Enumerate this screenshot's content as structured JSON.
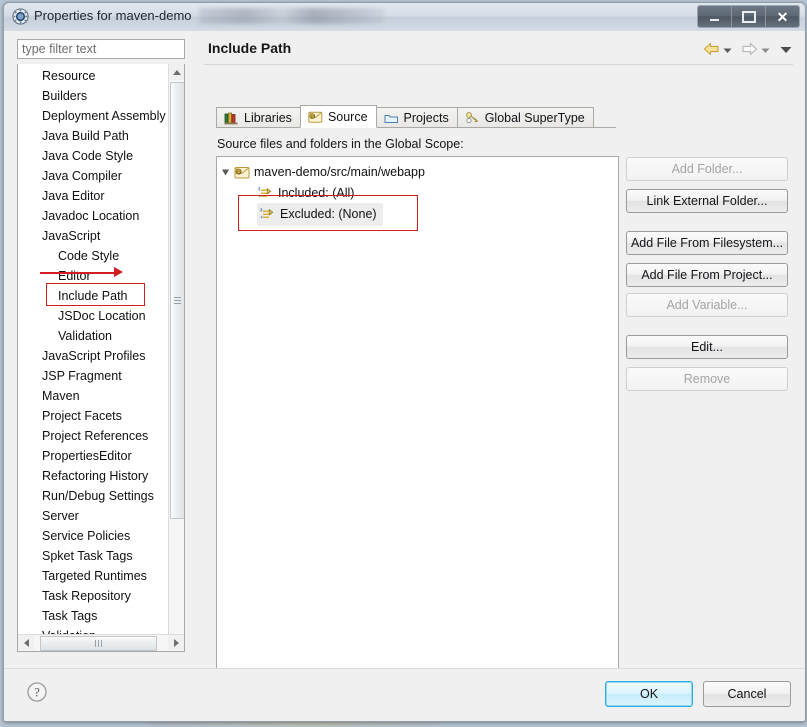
{
  "window": {
    "title": "Properties for maven-demo",
    "icon": "gear-icon",
    "controls": {
      "minimize": "Minimize",
      "maximize": "Maximize",
      "close": "Close"
    }
  },
  "filter": {
    "placeholder": "type filter text",
    "value": ""
  },
  "sidebar": {
    "items": [
      {
        "label": "Resource",
        "level": 0,
        "selected": false
      },
      {
        "label": "Builders",
        "level": 0,
        "selected": false
      },
      {
        "label": "Deployment Assembly",
        "level": 0,
        "selected": false
      },
      {
        "label": "Java Build Path",
        "level": 0,
        "selected": false
      },
      {
        "label": "Java Code Style",
        "level": 0,
        "selected": false
      },
      {
        "label": "Java Compiler",
        "level": 0,
        "selected": false
      },
      {
        "label": "Java Editor",
        "level": 0,
        "selected": false
      },
      {
        "label": "Javadoc Location",
        "level": 0,
        "selected": false
      },
      {
        "label": "JavaScript",
        "level": 0,
        "selected": false
      },
      {
        "label": "Code Style",
        "level": 1,
        "selected": false
      },
      {
        "label": "Editor",
        "level": 1,
        "selected": false
      },
      {
        "label": "Include Path",
        "level": 1,
        "selected": true
      },
      {
        "label": "JSDoc Location",
        "level": 1,
        "selected": false
      },
      {
        "label": "Validation",
        "level": 1,
        "selected": false
      },
      {
        "label": "JavaScript Profiles",
        "level": 0,
        "selected": false
      },
      {
        "label": "JSP Fragment",
        "level": 0,
        "selected": false
      },
      {
        "label": "Maven",
        "level": 0,
        "selected": false
      },
      {
        "label": "Project Facets",
        "level": 0,
        "selected": false
      },
      {
        "label": "Project References",
        "level": 0,
        "selected": false
      },
      {
        "label": "PropertiesEditor",
        "level": 0,
        "selected": false
      },
      {
        "label": "Refactoring History",
        "level": 0,
        "selected": false
      },
      {
        "label": "Run/Debug Settings",
        "level": 0,
        "selected": false
      },
      {
        "label": "Server",
        "level": 0,
        "selected": false
      },
      {
        "label": "Service Policies",
        "level": 0,
        "selected": false
      },
      {
        "label": "Spket Task Tags",
        "level": 0,
        "selected": false
      },
      {
        "label": "Targeted Runtimes",
        "level": 0,
        "selected": false
      },
      {
        "label": "Task Repository",
        "level": 0,
        "selected": false
      },
      {
        "label": "Task Tags",
        "level": 0,
        "selected": false
      },
      {
        "label": "Validation",
        "level": 0,
        "selected": false
      }
    ]
  },
  "page": {
    "title": "Include Path",
    "nav": {
      "back_icon": "back-arrow-icon",
      "back_menu_icon": "chevron-down-icon",
      "forward_icon": "forward-arrow-icon",
      "forward_menu_icon": "chevron-down-icon",
      "more_menu_icon": "chevron-down-icon"
    }
  },
  "tabs": [
    {
      "label": "Libraries",
      "icon": "libraries-icon",
      "active": false
    },
    {
      "label": "Source",
      "icon": "source-folder-icon",
      "active": true
    },
    {
      "label": "Projects",
      "icon": "projects-icon",
      "active": false
    },
    {
      "label": "Global SuperType",
      "icon": "supertype-icon",
      "active": false
    }
  ],
  "source_tab": {
    "description": "Source files and folders in the Global Scope:",
    "tree": [
      {
        "label": "maven-demo/src/main/webapp",
        "level": 0,
        "expanded": true,
        "icon": "source-folder-icon",
        "selected": false
      },
      {
        "label": "Included: (All)",
        "level": 1,
        "icon": "inclusion-filter-icon",
        "selected": false
      },
      {
        "label": "Excluded: (None)",
        "level": 1,
        "icon": "exclusion-filter-icon",
        "selected": true
      }
    ],
    "buttons": [
      {
        "label": "Add Folder...",
        "enabled": false
      },
      {
        "label": "Link External Folder...",
        "enabled": true
      },
      {
        "label": "Add File From Filesystem...",
        "enabled": true
      },
      {
        "label": "Add File From Project...",
        "enabled": true
      },
      {
        "label": "Add Variable...",
        "enabled": false
      },
      {
        "label": "Edit...",
        "enabled": true
      },
      {
        "label": "Remove",
        "enabled": false
      }
    ]
  },
  "footer": {
    "help_icon": "help-question-icon",
    "ok_label": "OK",
    "cancel_label": "Cancel"
  },
  "annotations": {
    "highlight_color": "#d31c22",
    "items": [
      {
        "name": "javascript-underline-arrow",
        "target": "JavaScript"
      },
      {
        "name": "include-path-box",
        "target": "Include Path"
      },
      {
        "name": "excluded-none-box",
        "target": "Excluded: (None)"
      }
    ]
  }
}
